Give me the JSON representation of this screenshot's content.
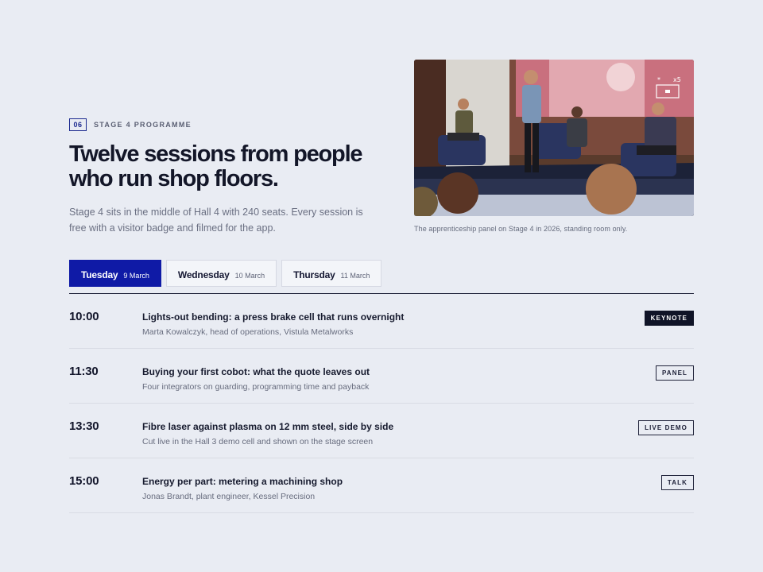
{
  "eyebrow": {
    "number": "06",
    "label": "STAGE 4 PROGRAMME"
  },
  "title": "Twelve sessions from people who run shop floors.",
  "lede": "Stage 4 sits in the middle of Hall 4 with 240 seats. Every session is free with a visitor badge and filmed for the app.",
  "photo": {
    "caption": "The apprenticeship panel on Stage 4 in 2026, standing room only.",
    "screen_overlay": "x5"
  },
  "tabs": [
    {
      "day": "Tuesday",
      "date": "9 March",
      "active": true
    },
    {
      "day": "Wednesday",
      "date": "10 March",
      "active": false
    },
    {
      "day": "Thursday",
      "date": "11 March",
      "active": false
    }
  ],
  "sessions": [
    {
      "time": "10:00",
      "title": "Lights-out bending: a press brake cell that runs overnight",
      "subtitle": "Marta Kowalczyk, head of operations, Vistula Metalworks",
      "tag": "KEYNOTE",
      "tag_style": "filled"
    },
    {
      "time": "11:30",
      "title": "Buying your first cobot: what the quote leaves out",
      "subtitle": "Four integrators on guarding, programming time and payback",
      "tag": "PANEL",
      "tag_style": "outline"
    },
    {
      "time": "13:30",
      "title": "Fibre laser against plasma on 12 mm steel, side by side",
      "subtitle": "Cut live in the Hall 3 demo cell and shown on the stage screen",
      "tag": "LIVE DEMO",
      "tag_style": "outline"
    },
    {
      "time": "15:00",
      "title": "Energy per part: metering a machining shop",
      "subtitle": "Jonas Brandt, plant engineer, Kessel Precision",
      "tag": "TALK",
      "tag_style": "outline"
    }
  ],
  "colors": {
    "accent": "#0f1aa6",
    "ink": "#131628",
    "background": "#e9ecf3"
  }
}
